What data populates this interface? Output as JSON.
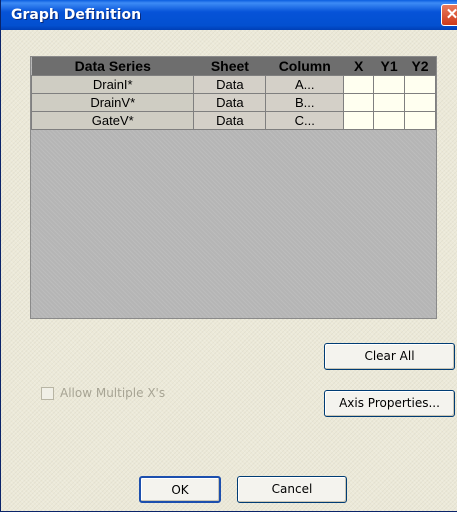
{
  "window": {
    "title": "Graph Definition",
    "close_glyph": "✕"
  },
  "table": {
    "headers": [
      "Data Series",
      "Sheet",
      "Column",
      "X",
      "Y1",
      "Y2"
    ],
    "rows": [
      {
        "series": "DrainI*",
        "sheet": "Data",
        "column": "A..."
      },
      {
        "series": "DrainV*",
        "sheet": "Data",
        "column": "B..."
      },
      {
        "series": "GateV*",
        "sheet": "Data",
        "column": "C..."
      }
    ]
  },
  "buttons": {
    "clear_all": "Clear All",
    "axis_properties": "Axis Properties...",
    "ok": "OK",
    "cancel": "Cancel"
  },
  "options": {
    "allow_multiple_x_label": "Allow Multiple X's",
    "allow_multiple_x_checked": false
  }
}
